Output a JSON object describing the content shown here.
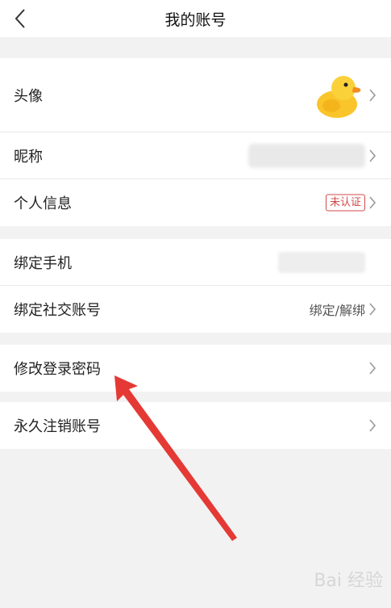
{
  "header": {
    "title": "我的账号",
    "back_icon": "back-chevron-icon"
  },
  "profile": {
    "avatar_label": "头像",
    "avatar_icon": "duck-avatar-icon",
    "nickname_label": "昵称",
    "personal_info_label": "个人信息",
    "personal_info_badge": "未认证"
  },
  "binding": {
    "phone_label": "绑定手机",
    "social_label": "绑定社交账号",
    "social_value": "绑定/解绑"
  },
  "security": {
    "change_password_label": "修改登录密码"
  },
  "account": {
    "delete_label": "永久注销账号"
  },
  "colors": {
    "accent": "#d04848",
    "arrow": "#e53935",
    "background": "#f2f2f2"
  },
  "watermark": "Bai 经验"
}
